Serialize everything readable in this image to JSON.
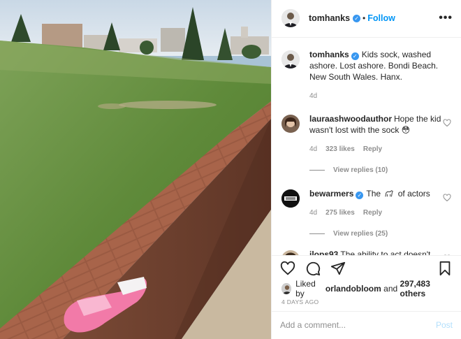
{
  "header": {
    "username": "tomhanks",
    "follow_label": "Follow",
    "separator": "•",
    "more_label": "•••"
  },
  "caption": {
    "username": "tomhanks",
    "text": "Kids sock, washed ashore. Lost ashore. Bondi Beach. New South Wales. Hanx.",
    "time": "4d"
  },
  "comments": [
    {
      "username": "lauraashwoodauthor",
      "text": "Hope the kid wasn't lost with the sock 😳",
      "time": "4d",
      "likes": "323 likes",
      "reply_label": "Reply",
      "view_replies": "View replies (10)"
    },
    {
      "username": "bewarmers",
      "text_before": "The",
      "text_after": "of actors",
      "emoji": "goat",
      "time": "4d",
      "likes": "275 likes",
      "reply_label": "Reply",
      "view_replies": "View replies (25)"
    },
    {
      "username": "jlops93",
      "text": "The ability to act doesn't"
    }
  ],
  "likes": {
    "prefix": "Liked by",
    "user": "orlandobloom",
    "and": "and",
    "count": "297,483 others"
  },
  "timestamp": "4 DAYS AGO",
  "composer": {
    "placeholder": "Add a comment...",
    "post_label": "Post"
  },
  "colors": {
    "accent": "#0095f6",
    "verified": "#3897f0",
    "muted": "#8e8e8e",
    "post_disabled": "#b2dffc"
  },
  "icons": [
    "heart-icon",
    "comment-icon",
    "share-icon",
    "bookmark-icon",
    "verified-icon",
    "more-icon"
  ]
}
